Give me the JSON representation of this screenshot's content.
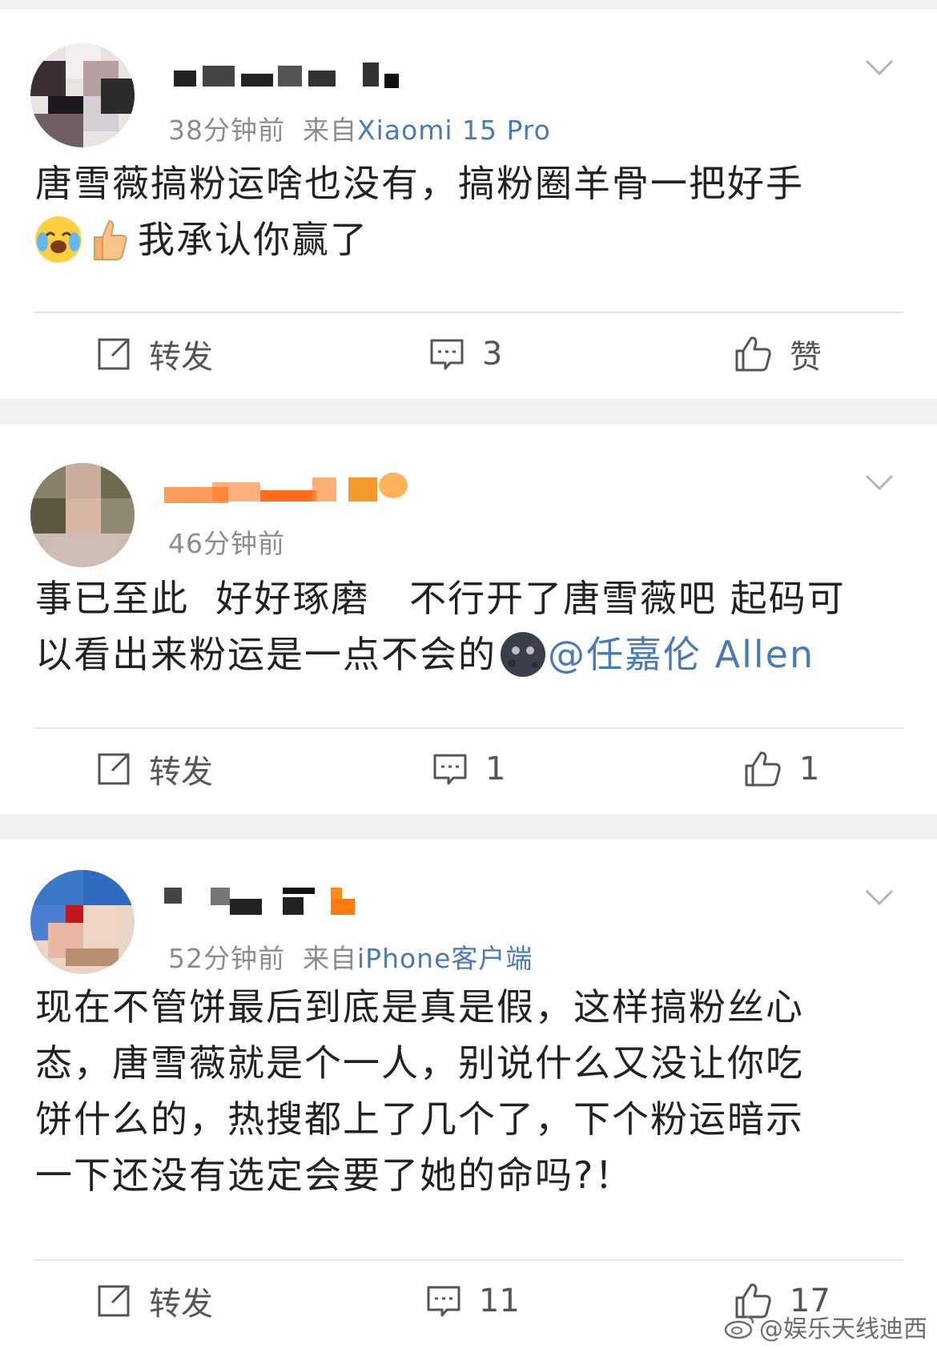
{
  "posts": [
    {
      "time": "38分钟前",
      "source_prefix": "来自",
      "source": "Xiaomi 15 Pro",
      "text_line1": "唐雪薇搞粉运啥也没有，搞粉圈羊骨一把好手",
      "text_line2": "我承认你赢了",
      "emojis": [
        "crying-laughing-face",
        "thumbs-up"
      ],
      "repost_label": "转发",
      "comment_count": "3",
      "like_label": "赞"
    },
    {
      "time": "46分钟前",
      "text_line1": "事已至此  好好琢磨   不行开了唐雪薇吧 起码可",
      "text_line2": "以看出来粉运是一点不会的",
      "emoji": "new-moon-face",
      "mention": "@任嘉伦 Allen",
      "repost_label": "转发",
      "comment_count": "1",
      "like_count": "1"
    },
    {
      "time": "52分钟前",
      "source_prefix": "来自",
      "source": "iPhone客户端",
      "text_line1": "现在不管饼最后到底是真是假，这样搞粉丝心",
      "text_line2": "态，唐雪薇就是个一人，别说什么又没让你吃",
      "text_line3": "饼什么的，热搜都上了几个了，下个粉运暗示",
      "text_line4": "一下还没有选定会要了她的命吗?！",
      "repost_label": "转发",
      "comment_count": "11",
      "like_count": "17"
    }
  ],
  "watermark": "@娱乐天线迪西",
  "colors": {
    "link": "#4a7ab5",
    "meta": "#8c8c8c",
    "background": "#f2f2f2",
    "card": "#ffffff"
  },
  "icons": [
    "chevron-down-icon",
    "repost-icon",
    "comment-icon",
    "like-icon",
    "weibo-logo-icon"
  ]
}
